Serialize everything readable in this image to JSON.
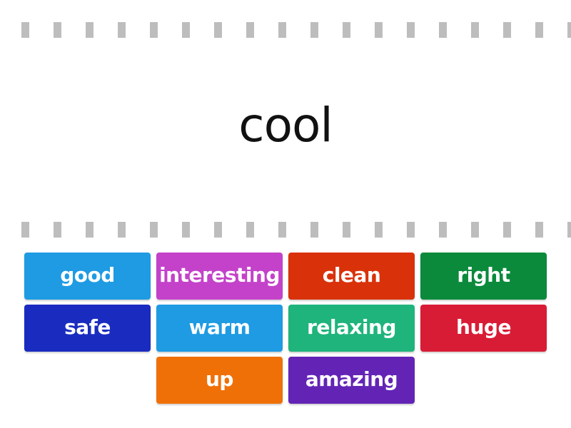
{
  "game": {
    "prompt_word": "cool",
    "tiles": [
      {
        "label": "good",
        "color": "#1e9be3",
        "col": 0,
        "row": 0
      },
      {
        "label": "interesting",
        "color": "#c442c9",
        "col": 1,
        "row": 0
      },
      {
        "label": "clean",
        "color": "#d9320a",
        "col": 2,
        "row": 0
      },
      {
        "label": "right",
        "color": "#0b8a3c",
        "col": 3,
        "row": 0
      },
      {
        "label": "safe",
        "color": "#1a2cbf",
        "col": 0,
        "row": 1
      },
      {
        "label": "warm",
        "color": "#1e9be3",
        "col": 1,
        "row": 1
      },
      {
        "label": "relaxing",
        "color": "#1fb47c",
        "col": 2,
        "row": 1
      },
      {
        "label": "huge",
        "color": "#d91c36",
        "col": 3,
        "row": 1
      },
      {
        "label": "up",
        "color": "#f07008",
        "col": 1,
        "row": 2
      },
      {
        "label": "amazing",
        "color": "#6324b5",
        "col": 2,
        "row": 2
      }
    ]
  }
}
